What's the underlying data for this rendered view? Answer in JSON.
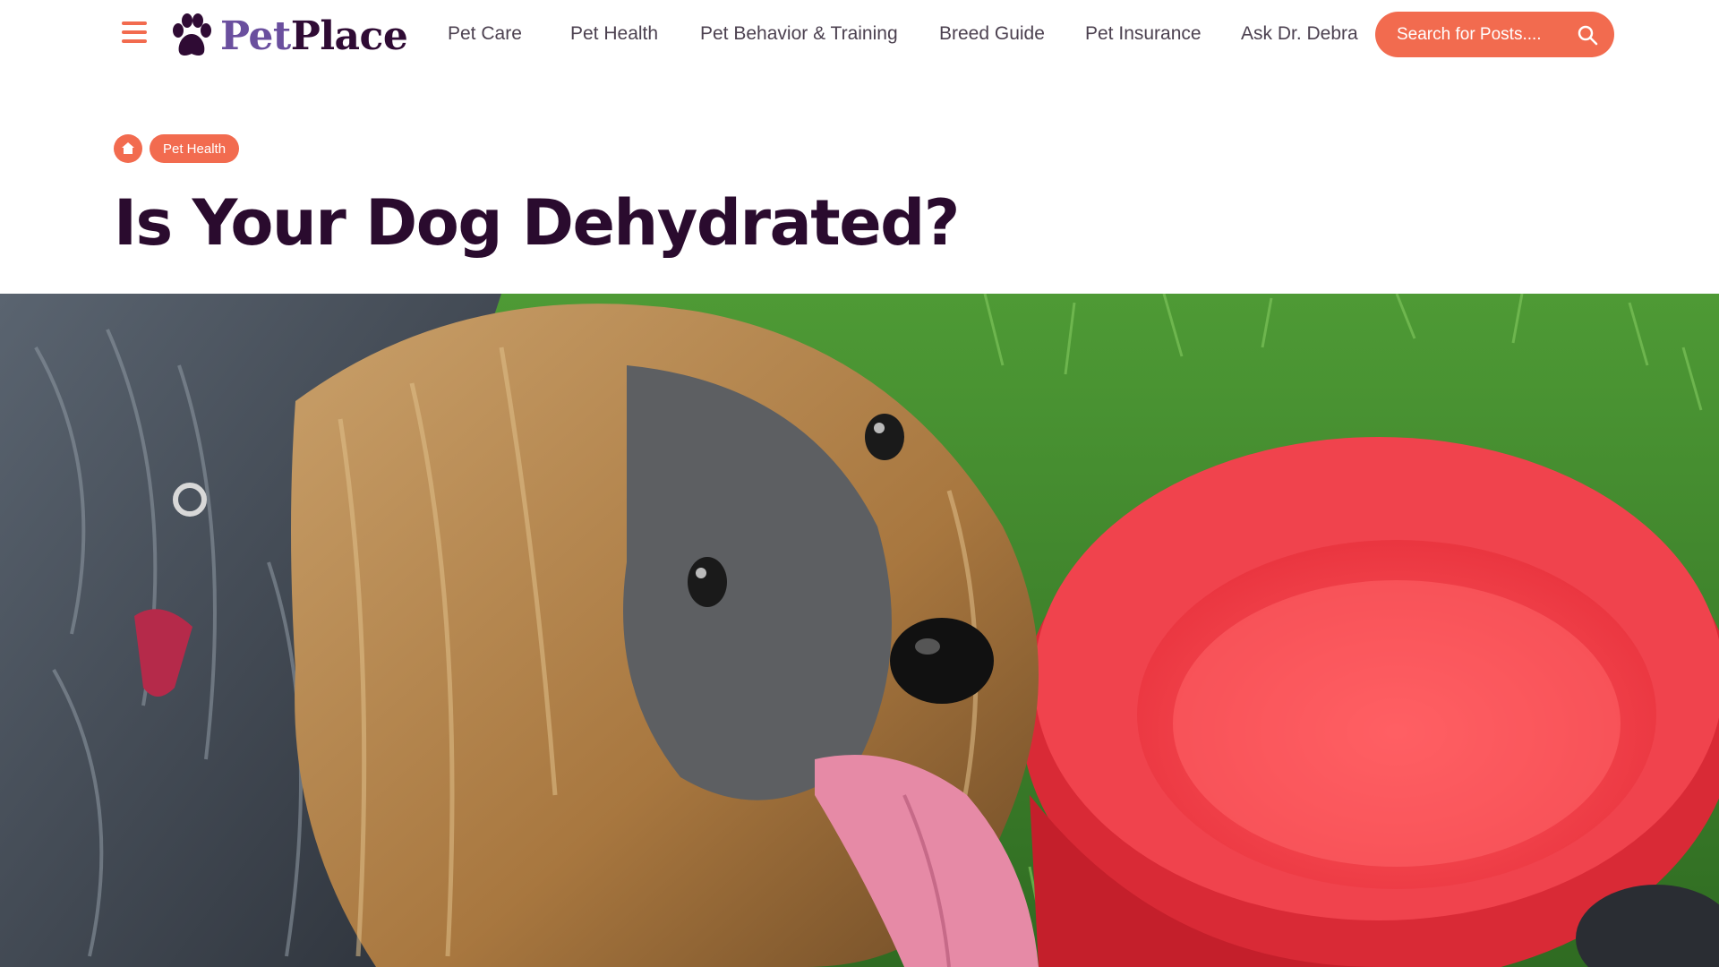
{
  "site": {
    "logo_part1": "Pet",
    "logo_part2": "Place"
  },
  "nav": {
    "items": [
      {
        "label": "Pet Care"
      },
      {
        "label": "Pet Health"
      },
      {
        "label": "Pet Behavior & Training"
      },
      {
        "label": "Breed Guide"
      },
      {
        "label": "Pet Insurance"
      },
      {
        "label": "Ask Dr. Debra"
      }
    ]
  },
  "search": {
    "placeholder": "Search for Posts...."
  },
  "breadcrumb": {
    "category": "Pet Health"
  },
  "article": {
    "title": "Is Your Dog Dehydrated?"
  },
  "colors": {
    "accent": "#f26b4f",
    "logo_purple": "#6a4f9e",
    "dark_plum": "#2a0b2e"
  },
  "icons": {
    "menu": "hamburger-menu-icon",
    "logo": "paw-icon",
    "search": "search-icon",
    "home": "home-icon"
  }
}
